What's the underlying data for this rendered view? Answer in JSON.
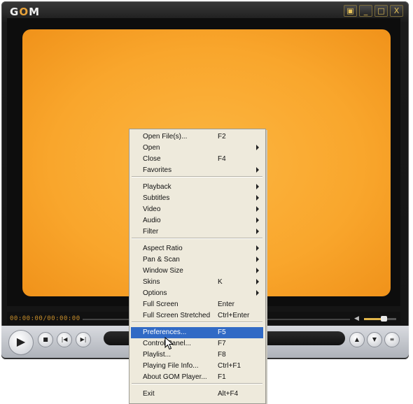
{
  "app": {
    "logo_left": "G",
    "logo_o": "O",
    "logo_right": "M",
    "window_buttons": [
      "▣",
      "_",
      "□",
      "X"
    ]
  },
  "colors": {
    "screen": "#f9a62c",
    "menu_bg": "#eeeadc",
    "highlight": "#316ac5"
  },
  "controls": {
    "time": "00:00:00/00:00:00",
    "volume_level": 0.6,
    "play_icon": "play-icon",
    "buttons": [
      "stop-icon",
      "prev-icon",
      "next-icon",
      "eject-icon",
      "menu-icon",
      "settings-icon"
    ]
  },
  "menu": {
    "items": [
      {
        "label": "Open File(s)...",
        "shortcut": "F2",
        "submenu": false
      },
      {
        "label": "Open",
        "shortcut": "",
        "submenu": true
      },
      {
        "label": "Close",
        "shortcut": "F4",
        "submenu": false
      },
      {
        "label": "Favorites",
        "shortcut": "",
        "submenu": true
      },
      {
        "label": "Playback",
        "shortcut": "",
        "submenu": true
      },
      {
        "label": "Subtitles",
        "shortcut": "",
        "submenu": true
      },
      {
        "label": "Video",
        "shortcut": "",
        "submenu": true
      },
      {
        "label": "Audio",
        "shortcut": "",
        "submenu": true
      },
      {
        "label": "Filter",
        "shortcut": "",
        "submenu": true
      },
      {
        "label": "Aspect Ratio",
        "shortcut": "",
        "submenu": true
      },
      {
        "label": "Pan & Scan",
        "shortcut": "",
        "submenu": true
      },
      {
        "label": "Window Size",
        "shortcut": "",
        "submenu": true
      },
      {
        "label": "Skins",
        "shortcut": "K",
        "submenu": true
      },
      {
        "label": "Options",
        "shortcut": "",
        "submenu": true
      },
      {
        "label": "Full Screen",
        "shortcut": "Enter",
        "submenu": false
      },
      {
        "label": "Full Screen Stretched",
        "shortcut": "Ctrl+Enter",
        "submenu": false
      },
      {
        "label": "Preferences...",
        "shortcut": "F5",
        "submenu": false,
        "highlighted": true
      },
      {
        "label": "Control Panel...",
        "shortcut": "F7",
        "submenu": false
      },
      {
        "label": "Playlist...",
        "shortcut": "F8",
        "submenu": false
      },
      {
        "label": "Playing File Info...",
        "shortcut": "Ctrl+F1",
        "submenu": false
      },
      {
        "label": "About GOM Player...",
        "shortcut": "F1",
        "submenu": false
      },
      {
        "label": "Exit",
        "shortcut": "Alt+F4",
        "submenu": false
      }
    ]
  }
}
